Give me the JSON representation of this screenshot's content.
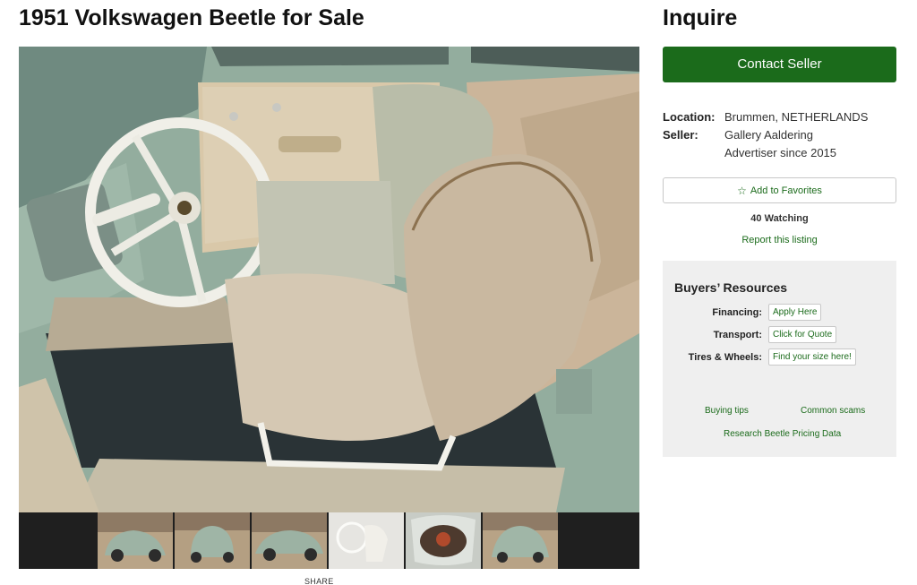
{
  "listing": {
    "title": "1951 Volkswagen Beetle for Sale"
  },
  "gallery": {
    "main_image": "1951 Volkswagen Beetle interior with beige seats and white steering wheel",
    "thumbnails": [
      "beetle-front-three-quarter",
      "beetle-rear",
      "beetle-side",
      "beetle-interior",
      "beetle-engine",
      "beetle-front"
    ],
    "share_label": "SHARE"
  },
  "sidebar": {
    "heading": "Inquire",
    "contact_label": "Contact Seller",
    "location_label": "Location:",
    "location_value": "Brummen, NETHERLANDS",
    "seller_label": "Seller:",
    "seller_name": "Gallery Aaldering",
    "seller_since": "Advertiser since 2015",
    "favorites_label": "Add to Favorites",
    "watching": "40 Watching",
    "report_label": "Report this listing"
  },
  "resources": {
    "title": "Buyers’ Resources",
    "rows": [
      {
        "label": "Financing:",
        "button": "Apply Here"
      },
      {
        "label": "Transport:",
        "button": "Click for Quote"
      },
      {
        "label": "Tires & Wheels:",
        "button": "Find your size here!"
      }
    ],
    "links": {
      "buying_tips": "Buying tips",
      "common_scams": "Common scams",
      "pricing": "Research Beetle Pricing Data"
    }
  },
  "colors": {
    "brand_green": "#1b6b1b",
    "panel_gray": "#efefef",
    "thumb_strip": "#1f1f1f"
  },
  "icons": {
    "favorite": "star-outline-icon"
  }
}
